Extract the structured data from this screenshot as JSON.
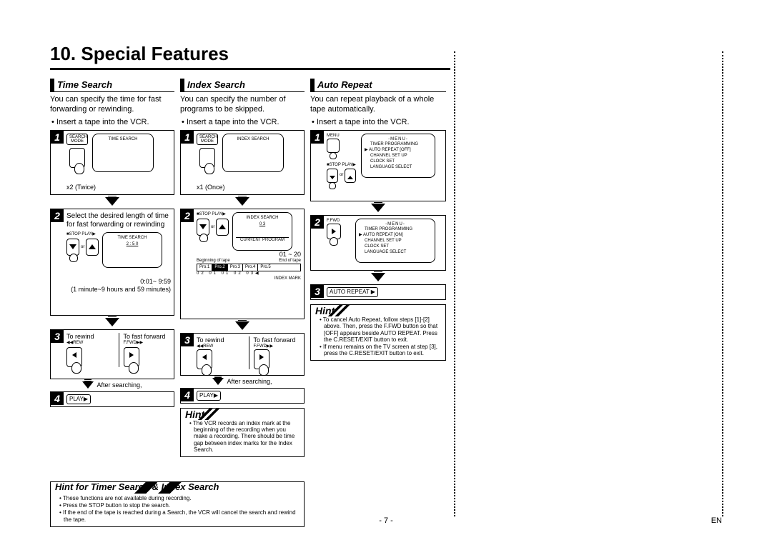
{
  "title": "10. Special Features",
  "col1": {
    "heading": "Time Search",
    "intro": "You can specify the time for fast forwarding or rewinding.",
    "bullet": "Insert a tape into the VCR.",
    "step1": {
      "btn": "SEARCH MODE",
      "screen": "TIME SEARCH",
      "caption": "x2 (Twice)"
    },
    "step2": {
      "text": "Select the desired length of time for fast forwarding or rewinding",
      "btns": "■STOP    PLAY▶",
      "screen_title": "TIME SEARCH",
      "screen_val": "2 : 5 0",
      "range": "0:01~ 9:59",
      "rangenote": "(1 minute~9 hours and 59 minutes)"
    },
    "step3": {
      "left": "To rewind",
      "right": "To fast forward",
      "lbtn": "◀◀REW",
      "rbtn": "F.FWD▶▶",
      "after": "After searching,"
    },
    "step4": "PLAY▶"
  },
  "col2": {
    "heading": "Index Search",
    "intro": "You can specify the number of programs to be skipped.",
    "bullet": "Insert a tape into the VCR.",
    "step1": {
      "btn": "SEARCH MODE",
      "screen": "INDEX SEARCH",
      "caption": "x1 (Once)"
    },
    "step2": {
      "btns": "■STOP    PLAY▶",
      "screen_title": "INDEX SEARCH",
      "screen_val": "0 3",
      "cp": "CURRENT PROGRAM",
      "range": "01 ~ 20",
      "beg": "Beginning of tape",
      "end": "End of tape",
      "progs": [
        "Pro.1",
        "Pro.2",
        "Pro.3",
        "Pro.4",
        "Pro.5"
      ],
      "marks": "02      01      01       02       03◀",
      "im": "INDEX MARK"
    },
    "step3": {
      "left": "To rewind",
      "right": "To fast forward",
      "lbtn": "◀◀REW",
      "rbtn": "F.FWD▶▶",
      "after": "After searching,"
    },
    "step4": "PLAY▶",
    "hint": [
      "The VCR records an index mark at the beginning of the recording when you make a recording. There should be time gap between index marks for the Index Search."
    ]
  },
  "col3": {
    "heading": "Auto Repeat",
    "intro": "You can repeat playback of a whole tape automatically.",
    "bullet": "Insert a tape into the VCR.",
    "step1": {
      "btn": "MENU",
      "btns": "■STOP    PLAY▶",
      "menutitle": "-MENU-",
      "menu": [
        "TIMER PROGRAMMING",
        "AUTO REPEAT   [OFF]",
        "CHANNEL SET UP",
        "CLOCK SET",
        "LANGUAGE SELECT"
      ],
      "sel": 1
    },
    "step2": {
      "btn": "F.FWD",
      "menutitle": "-MENU-",
      "menu": [
        "TIMER PROGRAMMING",
        "AUTO REPEAT   [ON]",
        "CHANNEL SET UP",
        "CLOCK SET",
        "LANGUAGE SELECT"
      ],
      "sel": 1
    },
    "step3": "AUTO REPEAT ▶",
    "hint": [
      "To cancel Auto Repeat, follow steps [1]-[2] above. Then, press the F.FWD button so that [OFF] appears beside AUTO REPEAT. Press the C.RESET/EXIT button to exit.",
      "If menu remains on the TV screen at step [3], press the C.RESET/EXIT button to exit."
    ]
  },
  "bottomhint": {
    "heading": "Hint for Timer Search & Index Search",
    "items": [
      "These functions are not available during recording.",
      "Press the STOP button to stop the search.",
      "If the end of the tape is reached during a Search, the VCR will cancel the search and rewind the tape."
    ]
  },
  "page": "- 7 -",
  "lang": "EN"
}
